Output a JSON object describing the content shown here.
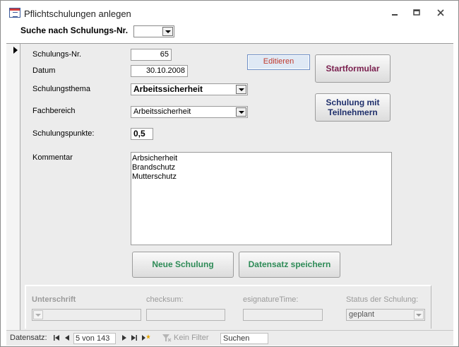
{
  "window": {
    "title": "Pflichtschulungen anlegen"
  },
  "header": {
    "search_label": "Suche nach Schulungs-Nr.",
    "search_value": ""
  },
  "form": {
    "nr_label": "Schulungs-Nr.",
    "nr_value": "65",
    "datum_label": "Datum",
    "datum_value": "30.10.2008",
    "thema_label": "Schulungsthema",
    "thema_value": "Arbeitssicherheit",
    "fachbereich_label": "Fachbereich",
    "fachbereich_value": "Arbeitssicherheit",
    "punkte_label": "Schulungspunkte:",
    "punkte_value": "0,5",
    "kommentar_label": "Kommentar",
    "kommentar_lines": [
      "Arbsicherheit",
      "Brandschutz",
      "Mutterschutz"
    ]
  },
  "buttons": {
    "editieren": "Editieren",
    "startformular": "Startformular",
    "schulung_line1": "Schulung mit",
    "schulung_line2": "Teilnehmern",
    "neue_schulung": "Neue Schulung",
    "speichern": "Datensatz speichern"
  },
  "signature": {
    "unterschrift_label": "Unterschrift",
    "checksum_label": "checksum:",
    "time_label": "esignatureTime:",
    "status_label": "Status der Schulung:",
    "status_value": "geplant"
  },
  "nav": {
    "label": "Datensatz:",
    "record": "5 von 143",
    "filter": "Kein Filter",
    "search": "Suchen"
  },
  "colors": {
    "editieren_text": "#c0392b",
    "startformular_text": "#7a1f4e",
    "schulung_text": "#1f2f6b",
    "green_text": "#2e8b57"
  }
}
